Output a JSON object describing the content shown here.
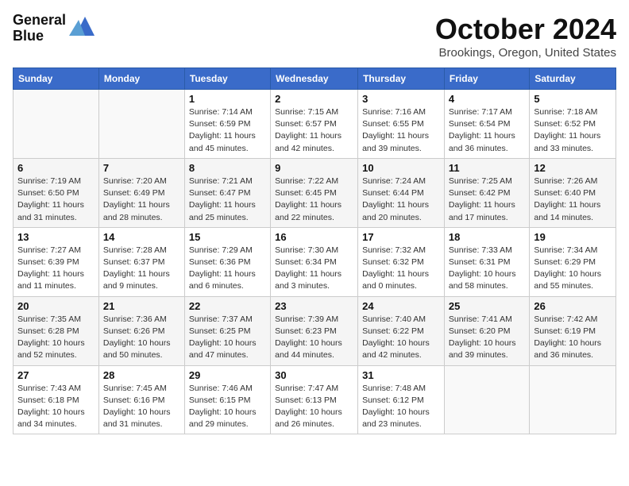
{
  "header": {
    "logo_line1": "General",
    "logo_line2": "Blue",
    "month": "October 2024",
    "location": "Brookings, Oregon, United States"
  },
  "weekdays": [
    "Sunday",
    "Monday",
    "Tuesday",
    "Wednesday",
    "Thursday",
    "Friday",
    "Saturday"
  ],
  "weeks": [
    [
      {
        "day": "",
        "info": ""
      },
      {
        "day": "",
        "info": ""
      },
      {
        "day": "1",
        "info": "Sunrise: 7:14 AM\nSunset: 6:59 PM\nDaylight: 11 hours and 45 minutes."
      },
      {
        "day": "2",
        "info": "Sunrise: 7:15 AM\nSunset: 6:57 PM\nDaylight: 11 hours and 42 minutes."
      },
      {
        "day": "3",
        "info": "Sunrise: 7:16 AM\nSunset: 6:55 PM\nDaylight: 11 hours and 39 minutes."
      },
      {
        "day": "4",
        "info": "Sunrise: 7:17 AM\nSunset: 6:54 PM\nDaylight: 11 hours and 36 minutes."
      },
      {
        "day": "5",
        "info": "Sunrise: 7:18 AM\nSunset: 6:52 PM\nDaylight: 11 hours and 33 minutes."
      }
    ],
    [
      {
        "day": "6",
        "info": "Sunrise: 7:19 AM\nSunset: 6:50 PM\nDaylight: 11 hours and 31 minutes."
      },
      {
        "day": "7",
        "info": "Sunrise: 7:20 AM\nSunset: 6:49 PM\nDaylight: 11 hours and 28 minutes."
      },
      {
        "day": "8",
        "info": "Sunrise: 7:21 AM\nSunset: 6:47 PM\nDaylight: 11 hours and 25 minutes."
      },
      {
        "day": "9",
        "info": "Sunrise: 7:22 AM\nSunset: 6:45 PM\nDaylight: 11 hours and 22 minutes."
      },
      {
        "day": "10",
        "info": "Sunrise: 7:24 AM\nSunset: 6:44 PM\nDaylight: 11 hours and 20 minutes."
      },
      {
        "day": "11",
        "info": "Sunrise: 7:25 AM\nSunset: 6:42 PM\nDaylight: 11 hours and 17 minutes."
      },
      {
        "day": "12",
        "info": "Sunrise: 7:26 AM\nSunset: 6:40 PM\nDaylight: 11 hours and 14 minutes."
      }
    ],
    [
      {
        "day": "13",
        "info": "Sunrise: 7:27 AM\nSunset: 6:39 PM\nDaylight: 11 hours and 11 minutes."
      },
      {
        "day": "14",
        "info": "Sunrise: 7:28 AM\nSunset: 6:37 PM\nDaylight: 11 hours and 9 minutes."
      },
      {
        "day": "15",
        "info": "Sunrise: 7:29 AM\nSunset: 6:36 PM\nDaylight: 11 hours and 6 minutes."
      },
      {
        "day": "16",
        "info": "Sunrise: 7:30 AM\nSunset: 6:34 PM\nDaylight: 11 hours and 3 minutes."
      },
      {
        "day": "17",
        "info": "Sunrise: 7:32 AM\nSunset: 6:32 PM\nDaylight: 11 hours and 0 minutes."
      },
      {
        "day": "18",
        "info": "Sunrise: 7:33 AM\nSunset: 6:31 PM\nDaylight: 10 hours and 58 minutes."
      },
      {
        "day": "19",
        "info": "Sunrise: 7:34 AM\nSunset: 6:29 PM\nDaylight: 10 hours and 55 minutes."
      }
    ],
    [
      {
        "day": "20",
        "info": "Sunrise: 7:35 AM\nSunset: 6:28 PM\nDaylight: 10 hours and 52 minutes."
      },
      {
        "day": "21",
        "info": "Sunrise: 7:36 AM\nSunset: 6:26 PM\nDaylight: 10 hours and 50 minutes."
      },
      {
        "day": "22",
        "info": "Sunrise: 7:37 AM\nSunset: 6:25 PM\nDaylight: 10 hours and 47 minutes."
      },
      {
        "day": "23",
        "info": "Sunrise: 7:39 AM\nSunset: 6:23 PM\nDaylight: 10 hours and 44 minutes."
      },
      {
        "day": "24",
        "info": "Sunrise: 7:40 AM\nSunset: 6:22 PM\nDaylight: 10 hours and 42 minutes."
      },
      {
        "day": "25",
        "info": "Sunrise: 7:41 AM\nSunset: 6:20 PM\nDaylight: 10 hours and 39 minutes."
      },
      {
        "day": "26",
        "info": "Sunrise: 7:42 AM\nSunset: 6:19 PM\nDaylight: 10 hours and 36 minutes."
      }
    ],
    [
      {
        "day": "27",
        "info": "Sunrise: 7:43 AM\nSunset: 6:18 PM\nDaylight: 10 hours and 34 minutes."
      },
      {
        "day": "28",
        "info": "Sunrise: 7:45 AM\nSunset: 6:16 PM\nDaylight: 10 hours and 31 minutes."
      },
      {
        "day": "29",
        "info": "Sunrise: 7:46 AM\nSunset: 6:15 PM\nDaylight: 10 hours and 29 minutes."
      },
      {
        "day": "30",
        "info": "Sunrise: 7:47 AM\nSunset: 6:13 PM\nDaylight: 10 hours and 26 minutes."
      },
      {
        "day": "31",
        "info": "Sunrise: 7:48 AM\nSunset: 6:12 PM\nDaylight: 10 hours and 23 minutes."
      },
      {
        "day": "",
        "info": ""
      },
      {
        "day": "",
        "info": ""
      }
    ]
  ]
}
